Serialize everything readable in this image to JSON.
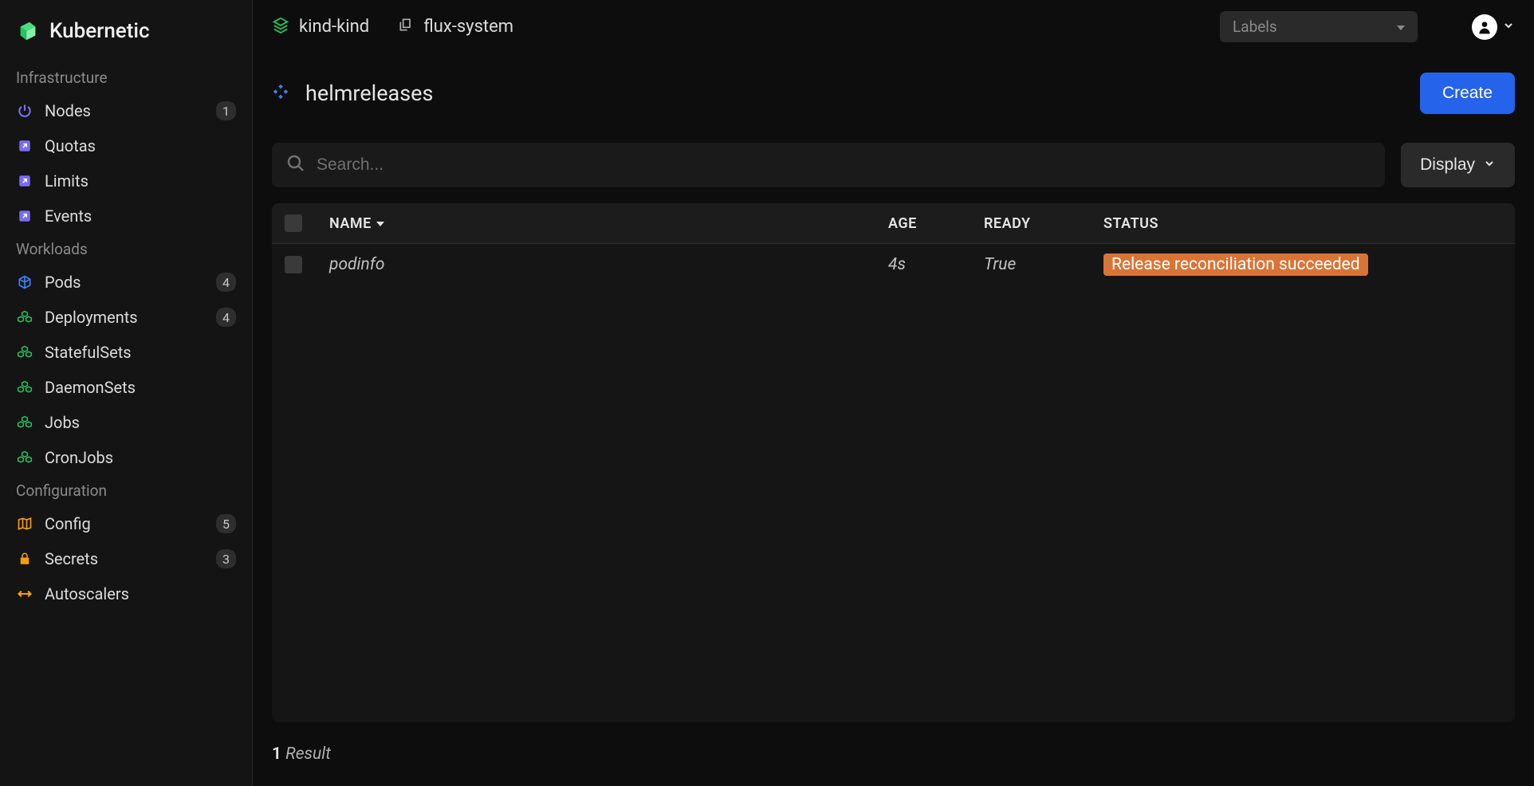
{
  "brand": {
    "name": "Kubernetic"
  },
  "sidebar": {
    "sections": [
      {
        "title": "Infrastructure",
        "items": [
          {
            "label": "Nodes",
            "badge": "1",
            "icon": "power",
            "color": "#7c6df2"
          },
          {
            "label": "Quotas",
            "badge": "",
            "icon": "external",
            "color": "#7c6df2"
          },
          {
            "label": "Limits",
            "badge": "",
            "icon": "external",
            "color": "#7c6df2"
          },
          {
            "label": "Events",
            "badge": "",
            "icon": "external",
            "color": "#7c6df2"
          }
        ]
      },
      {
        "title": "Workloads",
        "items": [
          {
            "label": "Pods",
            "badge": "4",
            "icon": "cube",
            "color": "#3b82f6"
          },
          {
            "label": "Deployments",
            "badge": "4",
            "icon": "cubes",
            "color": "#22c55e"
          },
          {
            "label": "StatefulSets",
            "badge": "",
            "icon": "cubes",
            "color": "#22c55e"
          },
          {
            "label": "DaemonSets",
            "badge": "",
            "icon": "cubes",
            "color": "#22c55e"
          },
          {
            "label": "Jobs",
            "badge": "",
            "icon": "cubes",
            "color": "#22c55e"
          },
          {
            "label": "CronJobs",
            "badge": "",
            "icon": "cubes",
            "color": "#22c55e"
          }
        ]
      },
      {
        "title": "Configuration",
        "items": [
          {
            "label": "Config",
            "badge": "5",
            "icon": "map",
            "color": "#f59e0b"
          },
          {
            "label": "Secrets",
            "badge": "3",
            "icon": "lock",
            "color": "#f59e0b"
          },
          {
            "label": "Autoscalers",
            "badge": "",
            "icon": "arrows",
            "color": "#f59e0b"
          }
        ]
      }
    ]
  },
  "breadcrumbs": {
    "cluster": "kind-kind",
    "namespace": "flux-system"
  },
  "labels_dropdown": {
    "placeholder": "Labels"
  },
  "page": {
    "title": "helmreleases",
    "create_label": "Create"
  },
  "search": {
    "placeholder": "Search..."
  },
  "display_button": {
    "label": "Display"
  },
  "table": {
    "headers": {
      "name": "NAME",
      "age": "AGE",
      "ready": "READY",
      "status": "STATUS"
    },
    "rows": [
      {
        "name": "podinfo",
        "age": "4s",
        "ready": "True",
        "status": "Release reconciliation succeeded"
      }
    ]
  },
  "results": {
    "count": "1",
    "label": "Result"
  }
}
